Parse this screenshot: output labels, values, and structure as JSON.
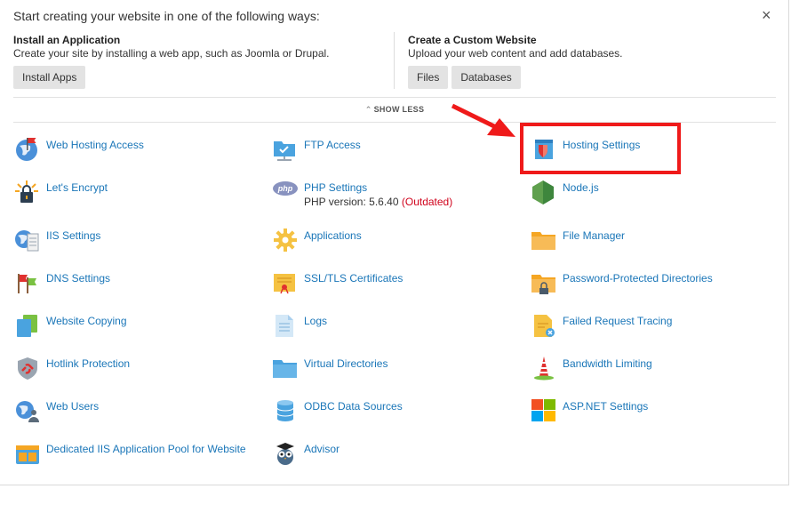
{
  "intro_text": "Start creating your website in one of the following ways:",
  "install": {
    "title": "Install an Application",
    "description": "Create your site by installing a web app, such as Joomla or Drupal.",
    "button": "Install Apps"
  },
  "custom": {
    "title": "Create a Custom Website",
    "description": "Upload your web content and add databases.",
    "buttons": [
      "Files",
      "Databases"
    ]
  },
  "show_less": "SHOW LESS",
  "close_glyph": "×",
  "tools": {
    "col1": [
      {
        "label": "Web Hosting Access",
        "icon": "globe-flag-icon"
      },
      {
        "label": "Let's Encrypt",
        "icon": "lock-sun-icon"
      },
      {
        "label": "IIS Settings",
        "icon": "globe-server-icon"
      },
      {
        "label": "DNS Settings",
        "icon": "flags-icon"
      },
      {
        "label": "Website Copying",
        "icon": "copy-pages-icon"
      },
      {
        "label": "Hotlink Protection",
        "icon": "broken-link-shield-icon"
      },
      {
        "label": "Web Users",
        "icon": "globe-users-icon"
      },
      {
        "label": "Dedicated IIS Application Pool for Website",
        "icon": "app-pool-icon"
      }
    ],
    "col2": [
      {
        "label": "FTP Access",
        "icon": "ftp-folder-icon"
      },
      {
        "label": "PHP Settings",
        "icon": "php-icon",
        "sub_prefix": "PHP version: 5.6.40",
        "sub_status": "(Outdated)"
      },
      {
        "label": "Applications",
        "icon": "gear-icon"
      },
      {
        "label": "SSL/TLS Certificates",
        "icon": "certificate-icon"
      },
      {
        "label": "Logs",
        "icon": "log-page-icon"
      },
      {
        "label": "Virtual Directories",
        "icon": "folder-icon"
      },
      {
        "label": "ODBC Data Sources",
        "icon": "database-icon"
      },
      {
        "label": "Advisor",
        "icon": "owl-icon"
      }
    ],
    "col3": [
      {
        "label": "Hosting Settings",
        "icon": "hosting-settings-icon"
      },
      {
        "label": "Node.js",
        "icon": "nodejs-icon"
      },
      {
        "label": "File Manager",
        "icon": "file-manager-icon"
      },
      {
        "label": "Password-Protected Directories",
        "icon": "locked-folder-icon"
      },
      {
        "label": "Failed Request Tracing",
        "icon": "failed-tracing-icon"
      },
      {
        "label": "Bandwidth Limiting",
        "icon": "bandwidth-tower-icon"
      },
      {
        "label": "ASP.NET Settings",
        "icon": "aspnet-icon"
      }
    ]
  },
  "colors": {
    "link": "#1a76b8",
    "highlight": "#ef1a1a",
    "outdated": "#d0021b"
  }
}
